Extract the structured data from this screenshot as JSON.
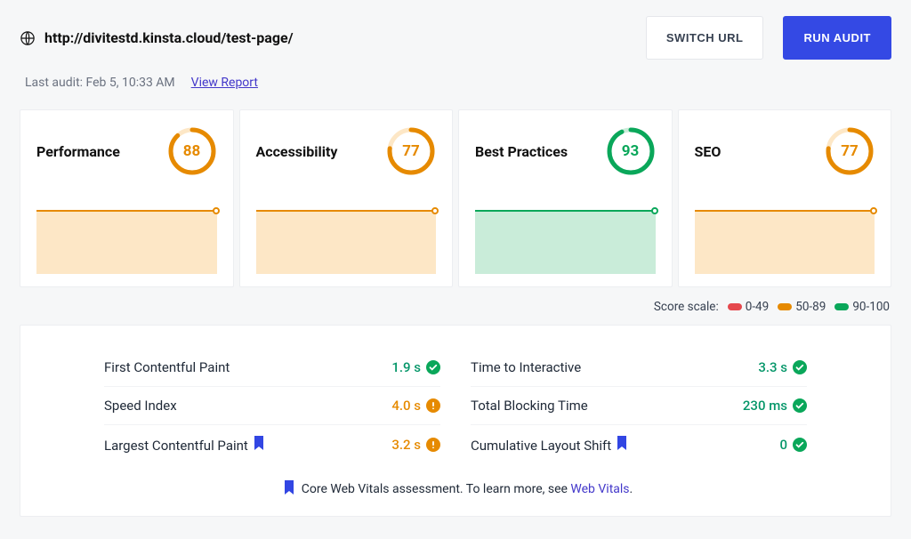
{
  "header": {
    "url": "http://divitestd.kinsta.cloud/test-page/",
    "switch_label": "SWITCH URL",
    "run_label": "RUN AUDIT",
    "last_audit_label": "Last audit: Feb 5, 10:33 AM",
    "view_report_label": "View Report"
  },
  "cards": [
    {
      "title": "Performance",
      "score": 88,
      "level": "orange"
    },
    {
      "title": "Accessibility",
      "score": 77,
      "level": "orange"
    },
    {
      "title": "Best Practices",
      "score": 93,
      "level": "green"
    },
    {
      "title": "SEO",
      "score": 77,
      "level": "orange"
    }
  ],
  "colors": {
    "green": {
      "stroke": "#0aa75a",
      "fill": "#c9ecd9",
      "text": "#0aa75a"
    },
    "orange": {
      "stroke": "#e68a00",
      "fill": "#fde7c6",
      "text": "#e68a00"
    },
    "red": {
      "stroke": "#e5484d",
      "fill": "#fdd7d7",
      "text": "#e5484d"
    }
  },
  "legend": {
    "label": "Score scale:",
    "items": [
      {
        "color": "#e5484d",
        "text": "0-49"
      },
      {
        "color": "#e68a00",
        "text": "50-89"
      },
      {
        "color": "#0aa75a",
        "text": "90-100"
      }
    ]
  },
  "metrics_left": [
    {
      "name": "First Contentful Paint",
      "value": "1.9 s",
      "status": "pass",
      "color": "green",
      "bookmark": false
    },
    {
      "name": "Speed Index",
      "value": "4.0 s",
      "status": "info",
      "color": "orange",
      "bookmark": false
    },
    {
      "name": "Largest Contentful Paint",
      "value": "3.2 s",
      "status": "info",
      "color": "orange",
      "bookmark": true
    }
  ],
  "metrics_right": [
    {
      "name": "Time to Interactive",
      "value": "3.3 s",
      "status": "pass",
      "color": "green",
      "bookmark": false
    },
    {
      "name": "Total Blocking Time",
      "value": "230 ms",
      "status": "pass",
      "color": "green",
      "bookmark": false
    },
    {
      "name": "Cumulative Layout Shift",
      "value": "0",
      "status": "pass",
      "color": "green",
      "bookmark": true
    }
  ],
  "cwv": {
    "text": "Core Web Vitals assessment. To learn more, see ",
    "link_text": "Web Vitals",
    "suffix": "."
  }
}
